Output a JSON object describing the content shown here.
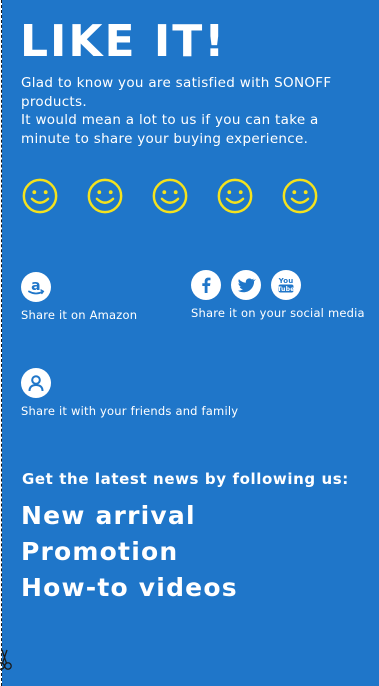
{
  "headline": "LIKE IT!",
  "message": {
    "line1": "Glad to know you are satisfied with SONOFF products.",
    "line2": "It would mean a lot to us if you can take a minute to share your buying experience."
  },
  "rating": {
    "faces": 5,
    "color": "#f4e21d"
  },
  "amazon": {
    "icon": "amazon-icon",
    "label": "Share it on Amazon"
  },
  "social": {
    "icons": [
      "facebook-icon",
      "twitter-icon",
      "youtube-icon"
    ],
    "label": "Share it on your social media"
  },
  "friends": {
    "icon": "person-icon",
    "label": "Share it with your friends and family"
  },
  "follow": {
    "title": "Get the latest news by following us:",
    "items": [
      "New arrival",
      "Promotion",
      "How-to videos"
    ]
  },
  "colors": {
    "background": "#1f76c9",
    "text": "#ffffff",
    "accent": "#f4e21d"
  }
}
